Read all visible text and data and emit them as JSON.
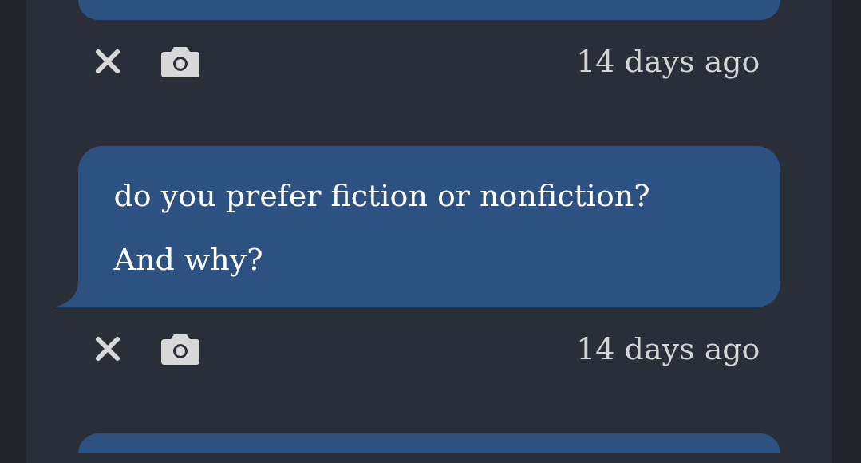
{
  "messages": [
    {
      "kind": "clipped-bottom",
      "time": "14 days ago"
    },
    {
      "kind": "full",
      "text": "do you prefer fiction or nonfiction?\nAnd why?",
      "time": "14 days ago"
    },
    {
      "kind": "clipped-top"
    }
  ]
}
